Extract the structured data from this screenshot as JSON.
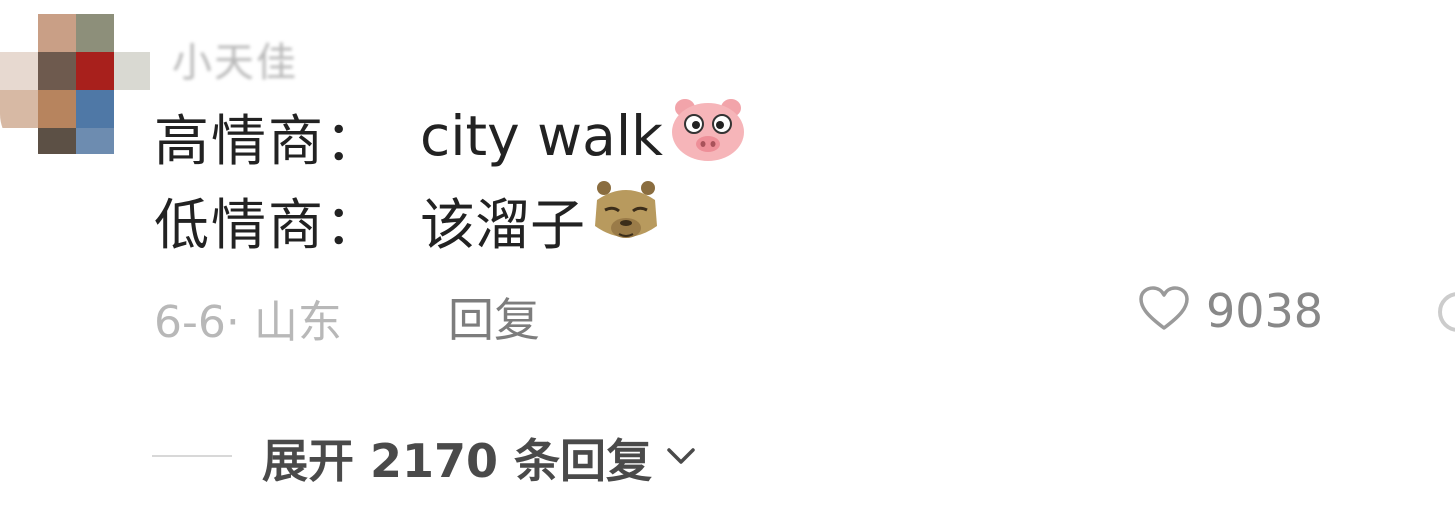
{
  "comment": {
    "username": "小天佳",
    "lines": [
      {
        "label": "高情商：",
        "content": "city walk",
        "emoji": "pig-face-emoji"
      },
      {
        "label": "低情商：",
        "content": "该溜子",
        "emoji": "capybara-face-emoji"
      }
    ],
    "meta": "6-6· 山东",
    "reply_label": "回复",
    "like_count": "9038"
  },
  "replies": {
    "expand_label": "展开 2170 条回复"
  },
  "colors": {
    "primary_text": "#222222",
    "secondary_text": "#b8b8b8",
    "action_text": "#7d7d7d",
    "pig_pink": "#f6b5b9",
    "capybara_brown": "#b89a5e"
  }
}
